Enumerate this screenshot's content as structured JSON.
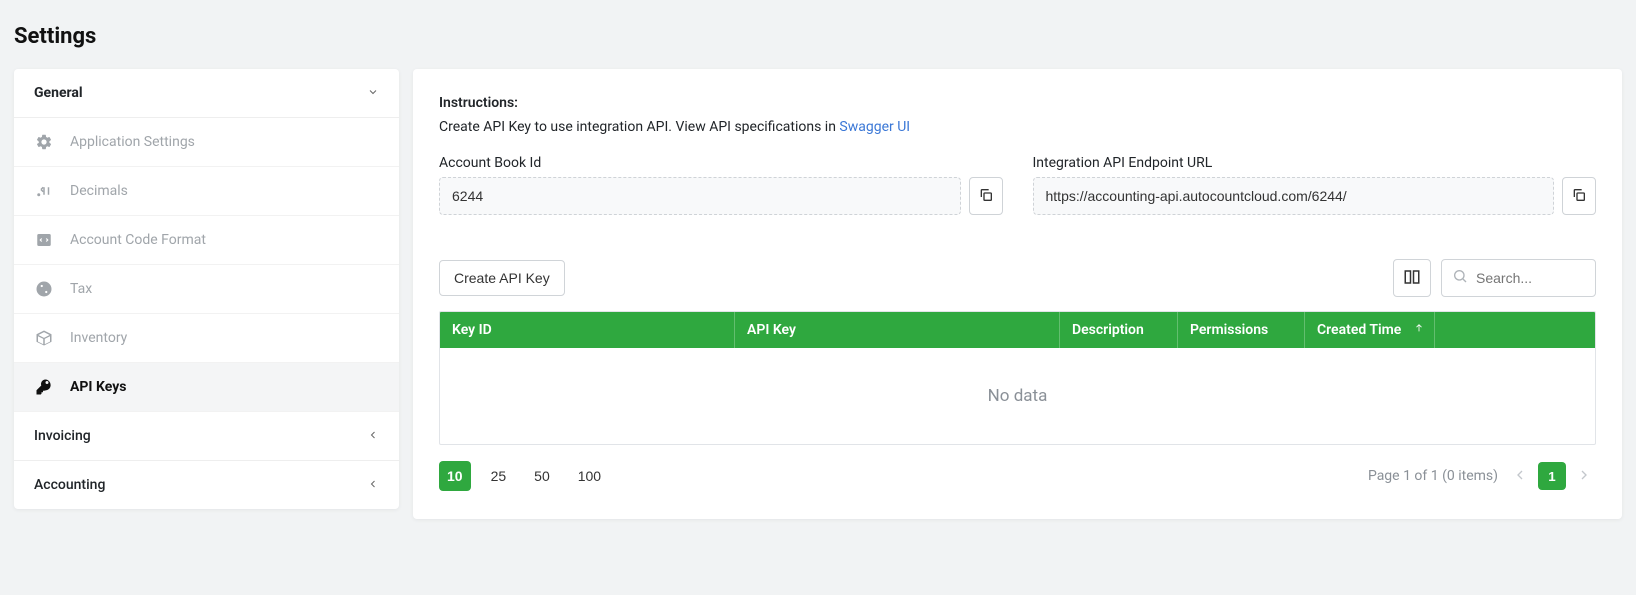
{
  "page": {
    "title": "Settings"
  },
  "sidebar": {
    "sections": {
      "general": {
        "label": "General"
      },
      "invoicing": {
        "label": "Invoicing"
      },
      "accounting": {
        "label": "Accounting"
      }
    },
    "general_items": [
      {
        "label": "Application Settings"
      },
      {
        "label": "Decimals"
      },
      {
        "label": "Account Code Format"
      },
      {
        "label": "Tax"
      },
      {
        "label": "Inventory"
      },
      {
        "label": "API Keys"
      }
    ]
  },
  "main": {
    "instructions_label": "Instructions:",
    "instructions_text_1": "Create API Key to use integration API. View API specifications in ",
    "swagger_link": "Swagger UI",
    "account_book_label": "Account Book Id",
    "account_book_value": "6244",
    "endpoint_label": "Integration API Endpoint URL",
    "endpoint_value": "https://accounting-api.autocountcloud.com/6244/",
    "create_btn": "Create API Key",
    "search_placeholder": "Search...",
    "table": {
      "columns": {
        "key_id": "Key ID",
        "api_key": "API Key",
        "description": "Description",
        "permissions": "Permissions",
        "created_time": "Created Time"
      },
      "no_data": "No data"
    },
    "pager": {
      "sizes": [
        "10",
        "25",
        "50",
        "100"
      ],
      "info": "Page 1 of 1 (0 items)",
      "current": "1"
    }
  },
  "colors": {
    "primary_green": "#2fa83f",
    "link_blue": "#3a77d6"
  }
}
